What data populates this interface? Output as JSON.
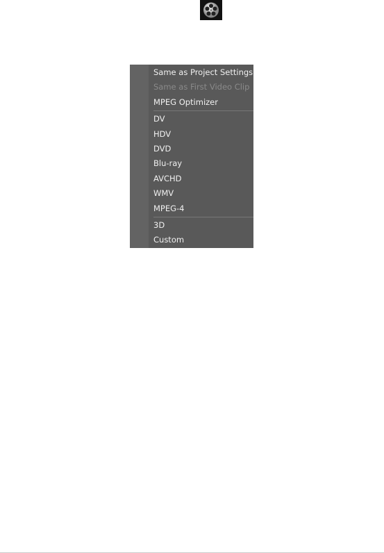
{
  "icon": "film-reel-icon",
  "menu": {
    "groups": [
      [
        {
          "label": "Same as Project Settings",
          "enabled": true
        },
        {
          "label": "Same as First Video Clip",
          "enabled": false
        },
        {
          "label": "MPEG Optimizer",
          "enabled": true
        }
      ],
      [
        {
          "label": "DV",
          "enabled": true
        },
        {
          "label": "HDV",
          "enabled": true
        },
        {
          "label": "DVD",
          "enabled": true
        },
        {
          "label": "Blu-ray",
          "enabled": true
        },
        {
          "label": "AVCHD",
          "enabled": true
        },
        {
          "label": "WMV",
          "enabled": true
        },
        {
          "label": "MPEG-4",
          "enabled": true
        }
      ],
      [
        {
          "label": "3D",
          "enabled": true
        },
        {
          "label": "Custom",
          "enabled": true
        }
      ]
    ]
  }
}
